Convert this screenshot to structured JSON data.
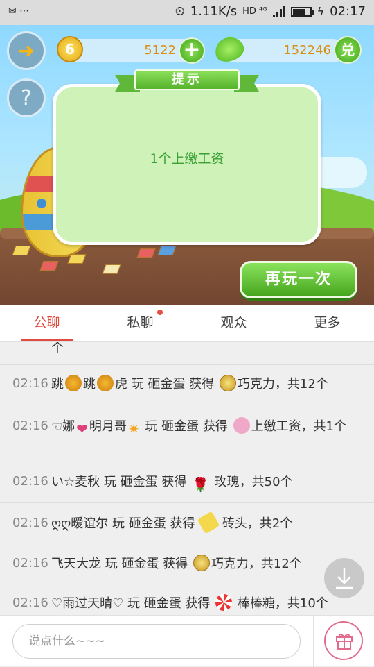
{
  "status_bar": {
    "left_icons": "✉ ⋯",
    "net_speed": "1.11K/s",
    "network": "HD ⁴ᴳ",
    "time": "02:17"
  },
  "game": {
    "coin_badge": "6",
    "coins": "5122",
    "gems": "152246",
    "redeem_label": "兑",
    "help_label": "?",
    "dialog_title": "提示",
    "dialog_message": "1个上缴工资",
    "replay_label": "再玩一次"
  },
  "tabs": [
    {
      "label": "公聊",
      "active": true
    },
    {
      "label": "私聊",
      "badge": true
    },
    {
      "label": "观众"
    },
    {
      "label": "更多"
    }
  ],
  "messages": {
    "partial_top": "个",
    "items": [
      {
        "time": "02:16",
        "pre": "跳",
        "mid": "跳",
        "post": "虎 玩 砸金蛋 获得 ",
        "tail": "巧克力，共12个"
      },
      {
        "time": "02:16",
        "text_a": "☜娜",
        "text_b": "明月哥",
        "text_c": " 玩 砸金蛋 获得 ",
        "text_d": "上缴工资，共1个"
      },
      {
        "time": "02:16",
        "pre": "い☆麦秋 玩 砸金蛋 获得 ",
        "tail": " 玫瑰，共50个"
      },
      {
        "time": "02:16",
        "pre": "ღღ暧谊尔 玩 砸金蛋 获得 ",
        "tail": " 砖头，共2个"
      },
      {
        "time": "02:16",
        "pre": "飞天大龙 玩 砸金蛋 获得 ",
        "tail": "巧克力，共12个"
      },
      {
        "time": "02:16",
        "pre": "♡雨过天晴♡ 玩 砸金蛋 获得 ",
        "tail": " 棒棒糖，共10个"
      }
    ]
  },
  "input": {
    "placeholder": "说点什么~~~"
  },
  "colors": {
    "accent": "#e14a3f",
    "button_green": "#45a51d",
    "dialog_text": "#3aa035"
  }
}
